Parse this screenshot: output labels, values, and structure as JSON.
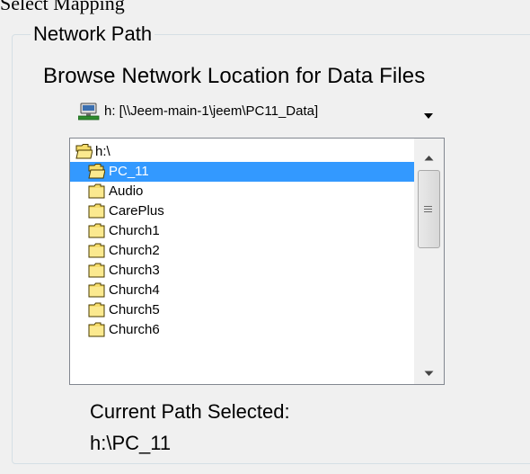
{
  "window": {
    "title": "Select Mapping"
  },
  "group": {
    "legend": "Network Path",
    "browse_label": "Browse Network Location for Data Files"
  },
  "drive_select": {
    "icon": "network-drive-icon",
    "value": "h: [\\\\Jeem-main-1\\jeem\\PC11_Data]"
  },
  "folders": [
    {
      "label": "h:\\",
      "icon": "open-folder-icon",
      "level": 0,
      "selected": false
    },
    {
      "label": "PC_11",
      "icon": "open-folder-icon",
      "level": 1,
      "selected": true
    },
    {
      "label": "Audio",
      "icon": "folder-icon",
      "level": 2,
      "selected": false
    },
    {
      "label": "CarePlus",
      "icon": "folder-icon",
      "level": 2,
      "selected": false
    },
    {
      "label": "Church1",
      "icon": "folder-icon",
      "level": 2,
      "selected": false
    },
    {
      "label": "Church2",
      "icon": "folder-icon",
      "level": 2,
      "selected": false
    },
    {
      "label": "Church3",
      "icon": "folder-icon",
      "level": 2,
      "selected": false
    },
    {
      "label": "Church4",
      "icon": "folder-icon",
      "level": 2,
      "selected": false
    },
    {
      "label": "Church5",
      "icon": "folder-icon",
      "level": 2,
      "selected": false
    },
    {
      "label": "Church6",
      "icon": "folder-icon",
      "level": 2,
      "selected": false
    }
  ],
  "current": {
    "label": "Current Path Selected:",
    "value": "h:\\PC_11"
  },
  "colors": {
    "selection": "#3399ff",
    "folder_yellow": "#f5dc6b",
    "group_border": "#d5dfe5"
  }
}
